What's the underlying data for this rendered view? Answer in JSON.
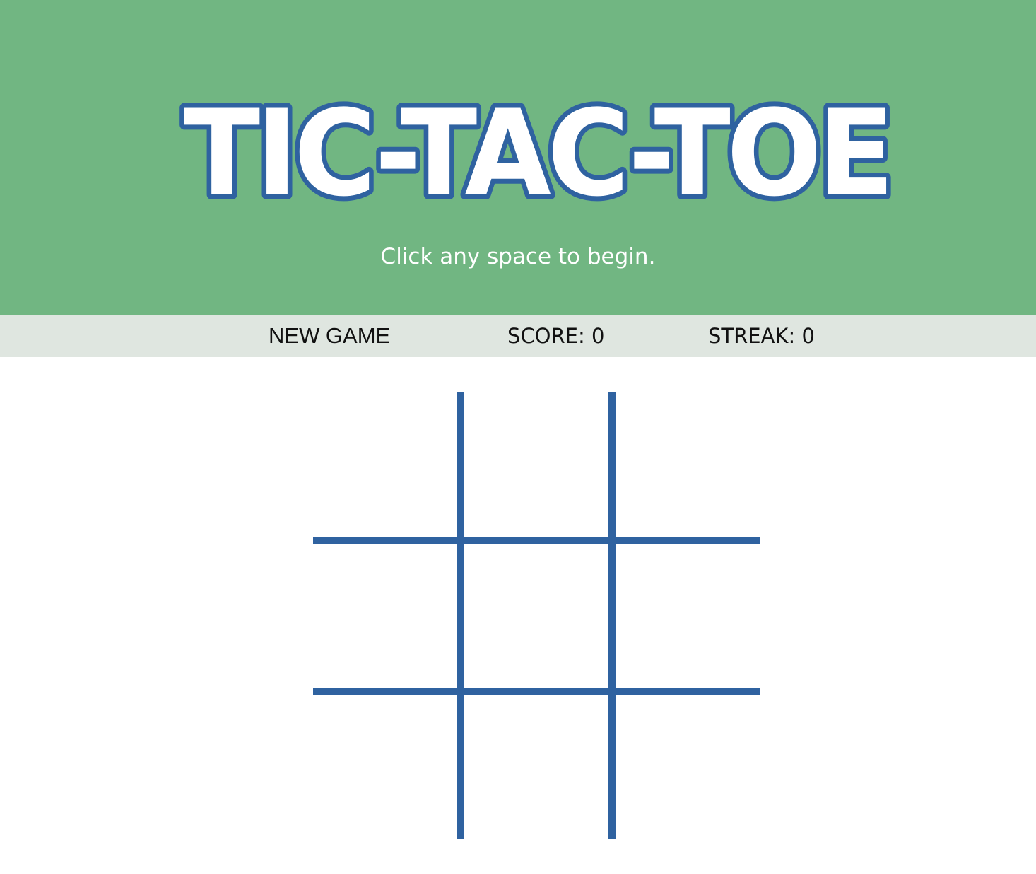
{
  "header": {
    "title": "TIC-TAC-TOE",
    "subtitle": "Click any space to begin.",
    "background_color": "#71b682",
    "title_fill_color": "#ffffff",
    "title_outline_color": "#2f62a0"
  },
  "toolbar": {
    "new_game_label": "NEW GAME",
    "score_label": "SCORE: 0",
    "streak_label": "STREAK: 0",
    "background_color": "#dfe6e0"
  },
  "board": {
    "grid_color": "#2f62a0",
    "cells": [
      "",
      "",
      "",
      "",
      "",
      "",
      "",
      "",
      ""
    ]
  }
}
